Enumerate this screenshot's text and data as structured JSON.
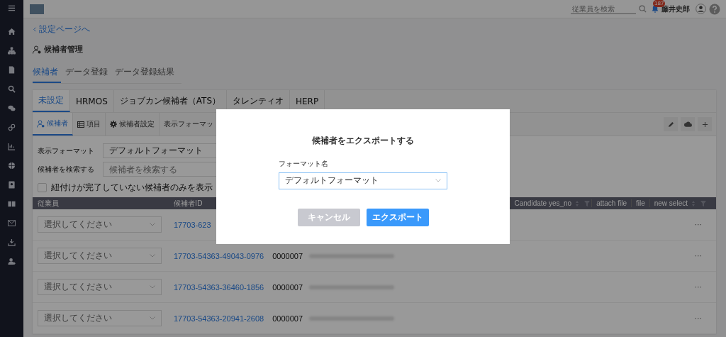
{
  "header": {
    "search": {
      "placeholder": "従業員を検索"
    },
    "notification_count": "187",
    "user_name": "藤井史郎"
  },
  "breadcrumb": "設定ページへ",
  "page_title": "候補者管理",
  "tabs": [
    {
      "label": "候補者",
      "selected": true
    },
    {
      "label": "データ登録",
      "selected": false
    },
    {
      "label": "データ登録結果",
      "selected": false
    }
  ],
  "integration_tabs": [
    {
      "label": "未設定",
      "selected": true
    },
    {
      "label": "HRMOS",
      "selected": false
    },
    {
      "label": "ジョブカン候補者（ATS）",
      "selected": false
    },
    {
      "label": "タレンティオ",
      "selected": false
    },
    {
      "label": "HERP",
      "selected": false
    }
  ],
  "view_tabs": [
    {
      "label": "候補者",
      "kind": "person",
      "selected": true
    },
    {
      "label": "項目",
      "kind": "table",
      "selected": false
    },
    {
      "label": "候補者設定",
      "kind": "gear",
      "selected": false
    },
    {
      "label": "表示フォーマッ",
      "kind": "plain",
      "selected": false
    }
  ],
  "form": {
    "format_label": "表示フォーマット",
    "format_value": "デフォルトフォーマット",
    "search_label": "候補者を検索する",
    "search_placeholder": "候補者を検索する",
    "unlinked_only": {
      "label": "紐付けが完了していない候補者のみを表示",
      "checked": false
    }
  },
  "table": {
    "columns_left": [
      "従業員",
      "候補者ID"
    ],
    "columns_right": [
      {
        "label": "Candidate yes_no",
        "sortable": true
      },
      {
        "label": "attach file",
        "sortable": false
      },
      {
        "label": "file",
        "sortable": false
      },
      {
        "label": "new select",
        "sortable": true
      }
    ],
    "rows": [
      {
        "employee_placeholder": "選択してください",
        "candidate_id": "17703-623",
        "actions": "···"
      },
      {
        "employee_placeholder": "選択してください",
        "candidate_id": "17703-54363-49043-0976",
        "number": "0000007",
        "actions": "···"
      },
      {
        "employee_placeholder": "選択してください",
        "candidate_id": "17703-54363-36460-1856",
        "number": "0000007",
        "actions": "···"
      },
      {
        "employee_placeholder": "選択してください",
        "candidate_id": "17703-54363-20941-2608",
        "number": "0000007",
        "actions": "···"
      }
    ]
  },
  "modal": {
    "title": "候補者をエクスポートする",
    "field_label": "フォーマット名",
    "field_value": "デフォルトフォーマット",
    "buttons": [
      {
        "label": "キャンセル",
        "kind": "secondary"
      },
      {
        "label": "エクスポート",
        "kind": "primary"
      }
    ]
  }
}
